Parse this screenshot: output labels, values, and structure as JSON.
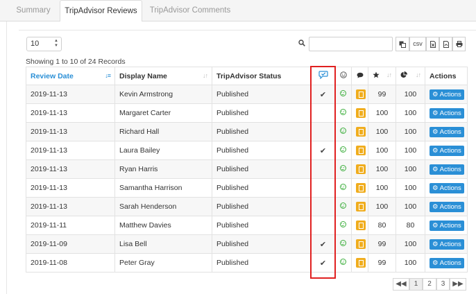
{
  "tabs": [
    {
      "label": "Summary",
      "active": false
    },
    {
      "label": "TripAdvisor Reviews",
      "active": true
    },
    {
      "label": "TripAdvisor Comments",
      "active": false
    }
  ],
  "page_size": {
    "value": "10"
  },
  "toolbar": {
    "csv_label": "csv"
  },
  "records_text": "Showing 1 to 10 of 24 Records",
  "table": {
    "headers": {
      "review_date": "Review Date",
      "display_name": "Display Name",
      "status": "TripAdvisor Status",
      "actions": "Actions"
    },
    "rows": [
      {
        "date": "2019-11-13",
        "name": "Kevin Armstrong",
        "status": "Published",
        "check": "✔",
        "v1": "99",
        "v2": "100",
        "action": "Actions"
      },
      {
        "date": "2019-11-13",
        "name": "Margaret Carter",
        "status": "Published",
        "check": "",
        "v1": "100",
        "v2": "100",
        "action": "Actions"
      },
      {
        "date": "2019-11-13",
        "name": "Richard Hall",
        "status": "Published",
        "check": "",
        "v1": "100",
        "v2": "100",
        "action": "Actions"
      },
      {
        "date": "2019-11-13",
        "name": "Laura Bailey",
        "status": "Published",
        "check": "✔",
        "v1": "100",
        "v2": "100",
        "action": "Actions"
      },
      {
        "date": "2019-11-13",
        "name": "Ryan Harris",
        "status": "Published",
        "check": "",
        "v1": "100",
        "v2": "100",
        "action": "Actions"
      },
      {
        "date": "2019-11-13",
        "name": "Samantha Harrison",
        "status": "Published",
        "check": "",
        "v1": "100",
        "v2": "100",
        "action": "Actions"
      },
      {
        "date": "2019-11-13",
        "name": "Sarah Henderson",
        "status": "Published",
        "check": "",
        "v1": "100",
        "v2": "100",
        "action": "Actions"
      },
      {
        "date": "2019-11-11",
        "name": "Matthew Davies",
        "status": "Published",
        "check": "",
        "v1": "80",
        "v2": "80",
        "action": "Actions"
      },
      {
        "date": "2019-11-09",
        "name": "Lisa Bell",
        "status": "Published",
        "check": "✔",
        "v1": "99",
        "v2": "100",
        "action": "Actions"
      },
      {
        "date": "2019-11-08",
        "name": "Peter Gray",
        "status": "Published",
        "check": "✔",
        "v1": "99",
        "v2": "100",
        "action": "Actions"
      }
    ]
  },
  "pagination": {
    "pages": [
      "1",
      "2",
      "3"
    ],
    "current": "1"
  },
  "colors": {
    "accent": "#2a8fd6",
    "highlight": "#e02020",
    "note": "#f0ad1e",
    "smile": "#3cae3c"
  },
  "icons": [
    "search-icon",
    "copy-icon",
    "csv-icon",
    "excel-icon",
    "pdf-icon",
    "print-icon",
    "verified-chat-icon",
    "smile-icon",
    "comment-icon",
    "star-icon",
    "pie-chart-icon",
    "cog-icon",
    "first-page-icon",
    "last-page-icon",
    "check-icon",
    "note-icon"
  ]
}
